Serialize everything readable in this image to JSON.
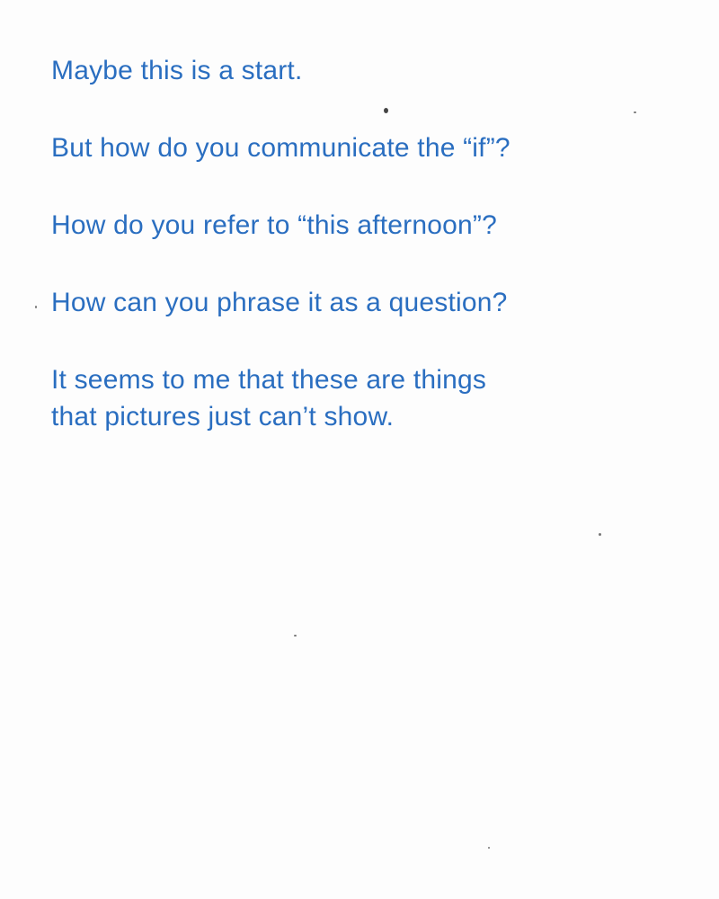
{
  "paragraphs": [
    "Maybe this is a start.",
    "But how do you communicate the “if”?",
    "How do you refer to “this afternoon”?",
    "How can you phrase it as a question?",
    "It seems to me that these are things\nthat pictures just can’t show."
  ],
  "colors": {
    "text": "#2a6ec0",
    "paper": "#fdfdfd"
  }
}
